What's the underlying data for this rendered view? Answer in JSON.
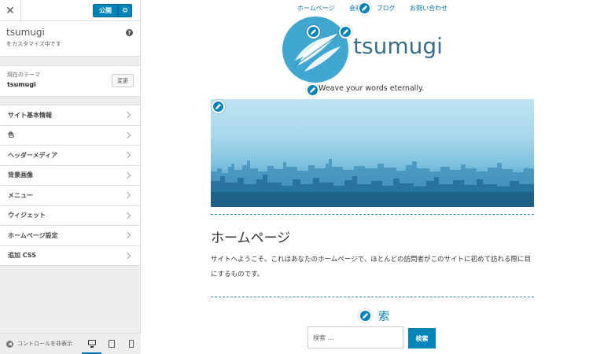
{
  "customizer": {
    "close_icon": "close-icon",
    "publish_label": "公開",
    "gear_icon": "gear-icon",
    "site_title": "tsumugi",
    "site_subtitle": "をカスタマイズ中です",
    "help_icon": "help-icon",
    "theme_caption": "現在のテーマ",
    "theme_name": "tsumugi",
    "change_label": "変更",
    "menu": [
      {
        "label": "サイト基本情報"
      },
      {
        "label": "色"
      },
      {
        "label": "ヘッダーメディア"
      },
      {
        "label": "背景画像"
      },
      {
        "label": "メニュー"
      },
      {
        "label": "ウィジェット"
      },
      {
        "label": "ホームページ設定"
      },
      {
        "label": "追加 CSS"
      }
    ],
    "collapse_label": "コントロールを非表示",
    "accent_color": "#0085ba"
  },
  "preview": {
    "nav": [
      "ホームページ",
      "会社",
      "ブログ",
      "お問い合わせ"
    ],
    "logo_text": "tsumugi",
    "tagline": "Weave your words eternally.",
    "page_title": "ホームページ",
    "page_body": "サイトへようこそ。これはあなたのホームページで、ほとんどの訪問者がこのサイトに初めて訪れる際に目にするものです。",
    "search_title": "索",
    "search_placeholder": "検索 …",
    "search_button": "検索",
    "edit_icon": "pencil-icon"
  }
}
